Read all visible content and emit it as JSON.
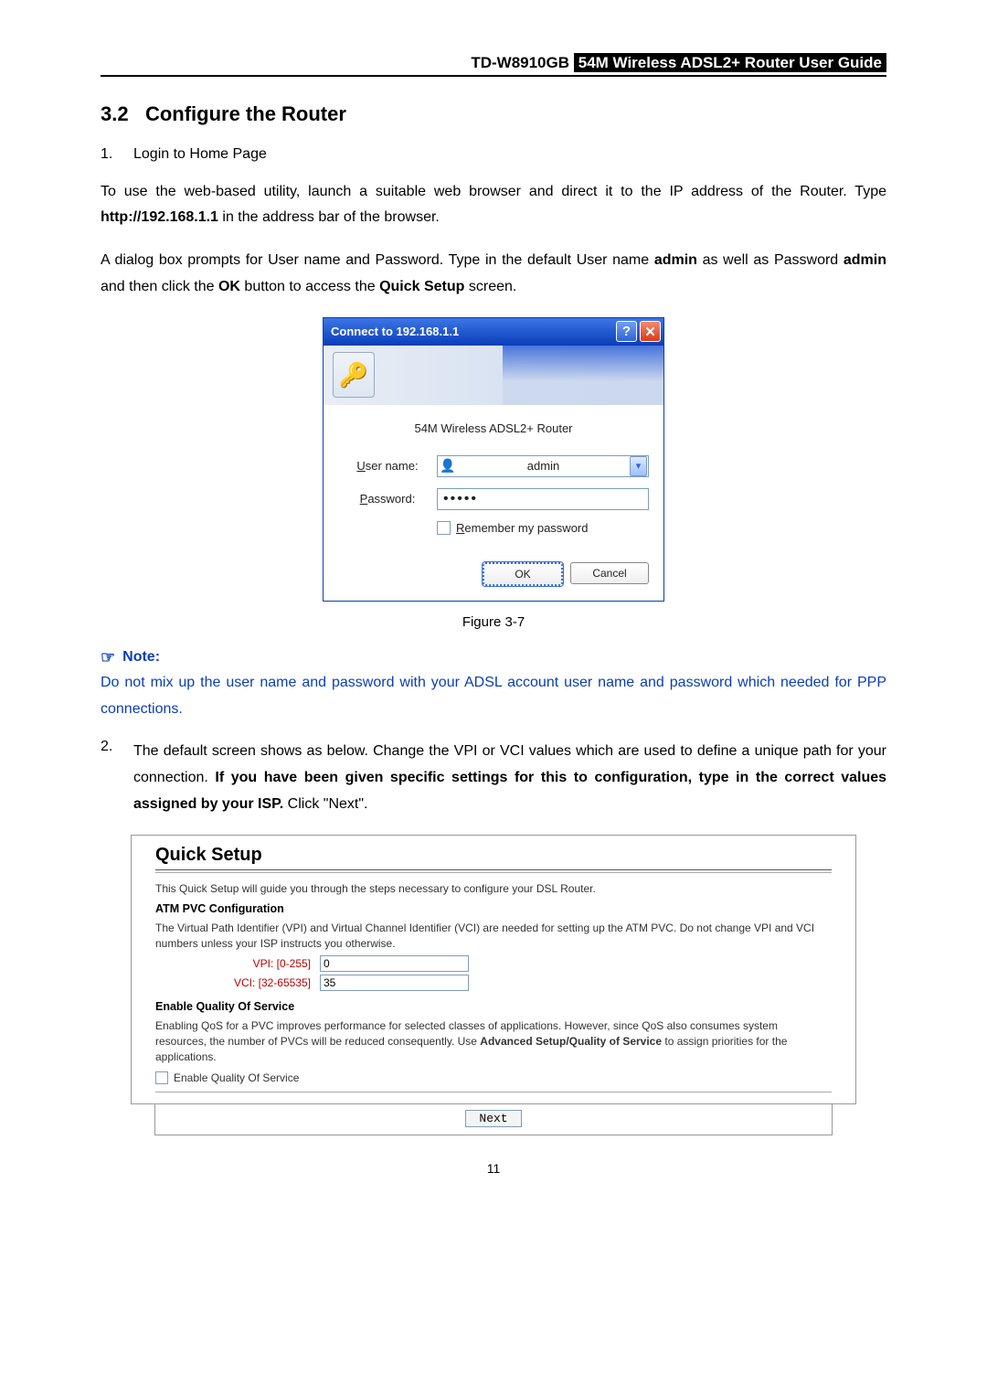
{
  "header": {
    "model": "TD-W8910GB",
    "title": " 54M  Wireless  ADSL2+  Router  User  Guide"
  },
  "section": {
    "number": "3.2",
    "title": "Configure the Router"
  },
  "step1": {
    "num": "1.",
    "text": "Login to Home Page"
  },
  "para1": {
    "a": "To use the web-based utility, launch a suitable web browser and direct it to the IP address of the Router. Type ",
    "url": "http://192.168.1.1",
    "b": " in the address bar of the browser."
  },
  "para2": {
    "a": "A dialog box prompts for User name and Password. Type in the default User name ",
    "admin1": "admin",
    "b": " as well as Password ",
    "admin2": "admin",
    "c": " and then click the ",
    "ok": "OK",
    "d": " button to access the ",
    "qs": "Quick Setup",
    "e": " screen."
  },
  "login": {
    "title": "Connect to 192.168.1.1",
    "realm": "54M Wireless ADSL2+ Router",
    "user_lbl_u": "U",
    "user_lbl_rest": "ser name:",
    "user_val": "admin",
    "pass_lbl_u": "P",
    "pass_lbl_rest": "assword:",
    "pass_val": "•••••",
    "remember_u": "R",
    "remember_rest": "emember my password",
    "ok": "OK",
    "cancel": "Cancel"
  },
  "fig_cap": "Figure 3-7",
  "note": {
    "head": "Note:",
    "body": "Do not mix up the user name and password with your ADSL account user name and password which needed for PPP connections."
  },
  "step2": {
    "num": "2.",
    "a": "The default screen shows as below. Change the VPI or VCI values which are used to define a unique path for your connection. ",
    "b": "If you have been given specific settings for this to configuration, type in the correct values assigned by your ISP.",
    "c": " Click \"Next\"."
  },
  "qs": {
    "title": "Quick Setup",
    "intro": "This Quick Setup will guide you through the steps necessary to configure your DSL Router.",
    "atm_title": "ATM PVC Configuration",
    "atm_desc": "The Virtual Path Identifier (VPI) and Virtual Channel Identifier (VCI) are needed for setting up the ATM PVC. Do not change VPI and VCI numbers unless your ISP instructs you otherwise.",
    "vpi_lbl": "VPI: [0-255]",
    "vpi_val": "0",
    "vci_lbl": "VCI: [32-65535]",
    "vci_val": "35",
    "qos_title": "Enable Quality Of Service",
    "qos_desc_a": "Enabling QoS for a PVC improves performance for selected classes of applications. However, since QoS also consumes system resources, the number of PVCs will be reduced consequently. Use ",
    "qos_desc_bold": "Advanced Setup/Quality of Service",
    "qos_desc_b": " to assign priorities for the applications.",
    "qos_chk": "Enable Quality Of Service",
    "next": "Next"
  },
  "page_no": "11"
}
